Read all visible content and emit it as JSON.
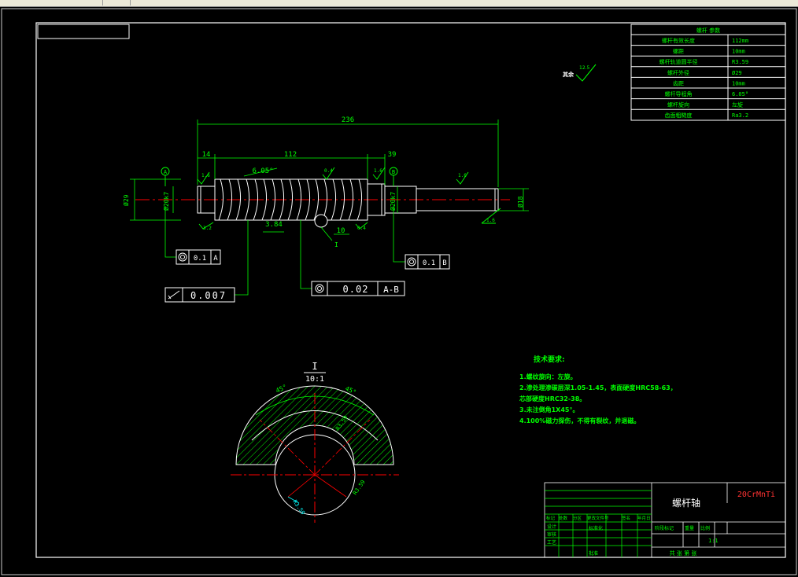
{
  "param_table": {
    "title": "螺杆 参数",
    "rows": [
      {
        "label": "螺杆有效长度",
        "value": "112mm"
      },
      {
        "label": "螺距",
        "value": "10mm"
      },
      {
        "label": "螺杆轨道圆半径",
        "value": "R3.59"
      },
      {
        "label": "螺杆外径",
        "value": "Ø29"
      },
      {
        "label": "齿距",
        "value": "10mm"
      },
      {
        "label": "螺杆导程角",
        "value": "6.05°"
      },
      {
        "label": "螺杆旋向",
        "value": "左旋"
      },
      {
        "label": "齿面粗糙度",
        "value": "Ra3.2"
      }
    ]
  },
  "roughness_note": {
    "prefix": "其余",
    "value": "12.5"
  },
  "dimensions": {
    "overall": "236",
    "len_left": "14",
    "len_mid": "112",
    "len_right": "39",
    "helix_angle": "6.05°",
    "thread_width": "3.84",
    "thread_pitch": "10",
    "dia_left": "Ø29",
    "dia_journal_left": "Ø20k7",
    "dia_journal_right": "Ø20k7",
    "dia_end": "Ø18",
    "rough_a": "1.6",
    "rough_b": "0.4",
    "rough_c": "1.6",
    "rough_d": "1.6",
    "rough_e": "3.2",
    "rough_f": "0.4",
    "rough_g": "1.6"
  },
  "datums": {
    "a": "A",
    "b": "B"
  },
  "section_marker": "I",
  "tolerances": {
    "left": {
      "value": "0.1",
      "ref": "A"
    },
    "right": {
      "value": "0.1",
      "ref": "B"
    },
    "cyl": {
      "value": "0.007"
    },
    "runout": {
      "value": "0.02",
      "ref": "A-B"
    }
  },
  "detail_view": {
    "label": "I",
    "scale": "10:1",
    "angle_left": "45°",
    "angle_right": "45°",
    "radius_a": "R3.59",
    "radius_b": "R3.59",
    "radius_c": "R3.59"
  },
  "tech_requirements": {
    "title": "技术要求:",
    "items": [
      "1.螺纹旋向：左旋。",
      "2.渗处理渗碳层深1.05-1.45，表面硬度HRC58-63，",
      "芯部硬度HRC32-38。",
      "3.未注倒角1X45°。",
      "4.100%磁力探伤，不得有裂纹，并退磁。"
    ]
  },
  "title_block": {
    "part_name": "螺杆轴",
    "material": "20CrMnTi",
    "header_cells": [
      "标记",
      "处数",
      "分区",
      "更改文件号",
      "签名",
      "年月日"
    ],
    "row_labels": [
      "设计",
      "审核",
      "工艺"
    ],
    "std": "标准化",
    "approve": "批准",
    "stage_labels": [
      "阶段标记",
      "重量",
      "比例"
    ],
    "scale": "1:1",
    "sheet": "共  张  第  张"
  },
  "colors": {
    "line": "#ffffff",
    "green": "#00ff00",
    "cyan": "#00ffff",
    "red": "#ff0000",
    "yellow": "#ffff00"
  }
}
